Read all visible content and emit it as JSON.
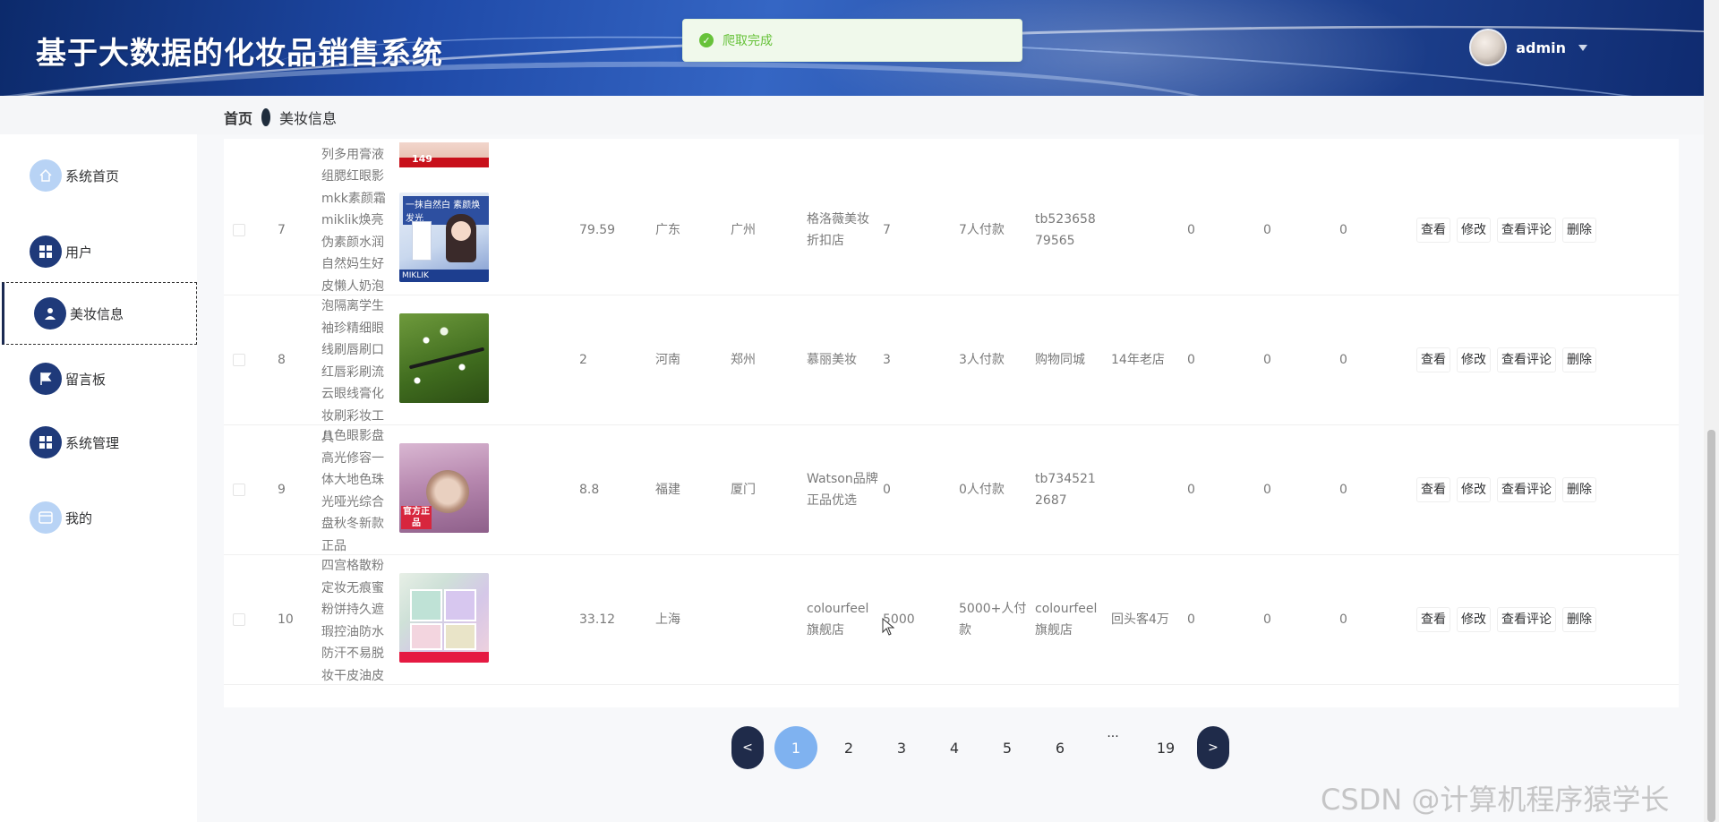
{
  "header": {
    "title": "基于大数据的化妆品销售系统",
    "user": "admin"
  },
  "toast": {
    "text": "爬取完成"
  },
  "breadcrumb": {
    "home": "首页",
    "current": "美妆信息"
  },
  "sidebar": {
    "items": [
      {
        "label": "系统首页",
        "icon": "home-icon"
      },
      {
        "label": "用户",
        "icon": "grid-icon"
      },
      {
        "label": "美妆信息",
        "icon": "person-icon"
      },
      {
        "label": "留言板",
        "icon": "flag-icon"
      },
      {
        "label": "系统管理",
        "icon": "grid-icon"
      },
      {
        "label": "我的",
        "icon": "wallet-icon"
      }
    ]
  },
  "table": {
    "partial_top": {
      "name": "列多用膏液",
      "badge": "149"
    },
    "rows": [
      {
        "index": "7",
        "name": "组腮红眼影mkk素颜霜miklik焕亮伪素颜水润自然妈生好皮懒人奶泡",
        "price": "79.59",
        "province": "广东",
        "city": "广州",
        "shop": "格洛薇美妆折扣店",
        "sales": "7",
        "buyers": "7人付款",
        "shopid": "tb52365879565",
        "tag": "",
        "c1": "0",
        "c2": "0",
        "c3": "0"
      },
      {
        "index": "8",
        "name": "泡隔离学生袖珍精细眼线刷唇刷口红唇彩刷流云眼线膏化妆刷彩妆工具",
        "price": "2",
        "province": "河南",
        "city": "郑州",
        "shop": "慕丽美妆",
        "sales": "3",
        "buyers": "3人付款",
        "shopid": "购物同城",
        "tag": "14年老店",
        "c1": "0",
        "c2": "0",
        "c3": "0"
      },
      {
        "index": "9",
        "name": "八色眼影盘高光修容一体大地色珠光哑光综合盘秋冬新款正品",
        "price": "8.8",
        "province": "福建",
        "city": "厦门",
        "shop": "Watson品牌正品优选",
        "sales": "0",
        "buyers": "0人付款",
        "shopid": "tb7345212687",
        "tag": "",
        "c1": "0",
        "c2": "0",
        "c3": "0"
      },
      {
        "index": "10",
        "name": "四宫格散粉定妆无痕蜜粉饼持久遮瑕控油防水防汗不易脱妆干皮油皮",
        "price": "33.12",
        "province": "上海",
        "city": "",
        "shop": "colourfeel旗舰店",
        "sales": "5000",
        "buyers": "5000+人付款",
        "shopid": "colourfeel旗舰店",
        "tag": "回头客4万",
        "c1": "0",
        "c2": "0",
        "c3": "0"
      }
    ],
    "actions": {
      "view": "查看",
      "edit": "修改",
      "comments": "查看评论",
      "delete": "删除"
    },
    "images": {
      "row7": {
        "banner": "一抹自然白 素颜焕发光",
        "brand": "MIKLIK"
      },
      "row9": {
        "badge": "官方正品"
      }
    }
  },
  "pagination": {
    "prev": "<",
    "next": ">",
    "pages": [
      "1",
      "2",
      "3",
      "4",
      "5",
      "6"
    ],
    "dots": "···",
    "last": "19",
    "current": "1"
  },
  "watermark": "CSDN @计算机程序猿学长"
}
